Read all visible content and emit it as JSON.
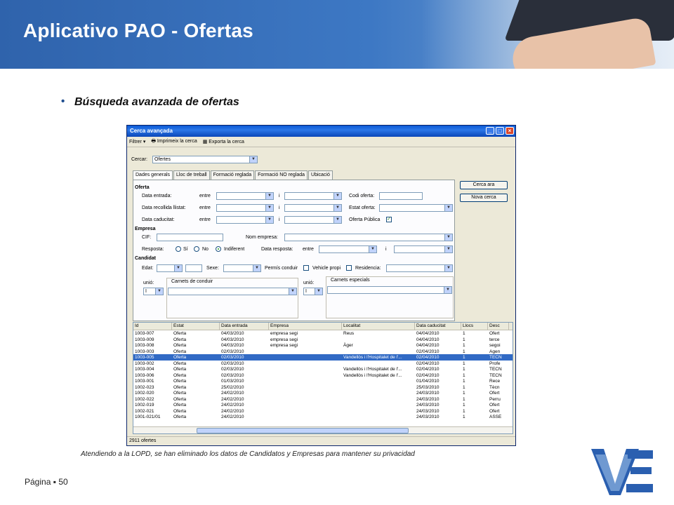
{
  "slide": {
    "title": "Aplicativo PAO - Ofertas",
    "bullet": "Búsqueda avanzada de ofertas",
    "footnote": "Atendiendo a la  LOPD, se han eliminado los datos de Candidatos y Empresas para mantener su privacidad",
    "page_label": "Página",
    "page_sep": "▪",
    "page_number": "50"
  },
  "window": {
    "title": "Cerca avançada",
    "toolbar": {
      "filter": "Filtrer",
      "print": "Imprimeix la cerca",
      "export": "Exporta la cerca"
    },
    "search_label": "Cercar:",
    "search_value": "Ofertes",
    "tabs": [
      "Dades generals",
      "Lloc de treball",
      "Formació reglada",
      "Formació NO reglada",
      "Ubicació"
    ],
    "buttons": {
      "search_now": "Cerca ara",
      "new_search": "Nova cerca"
    },
    "oferta": {
      "section": "Oferta",
      "data_entrada": "Data entrada:",
      "data_recollida": "Data recollida llistat:",
      "data_caducitat": "Data caducitat:",
      "entre": "entre",
      "i": "i",
      "codi_oferta": "Codi oferta:",
      "estat_oferta": "Estat oferta:",
      "oferta_publica": "Oferta Pública",
      "oferta_publica_checked": true
    },
    "empresa": {
      "section": "Empresa",
      "cif": "CIF:",
      "nom_empresa": "Nom empresa:",
      "resposta": "Resposta:",
      "si": "Sí",
      "no": "No",
      "indiferent": "Indiferent",
      "data_resposta": "Data resposta:"
    },
    "candidat": {
      "section": "Candidat",
      "edat": "Edat:",
      "sexe": "Sexe:",
      "permis": "Permís conduir",
      "vehicle": "Vehicle propi",
      "residencia": "Residencia:",
      "unio": "unió:",
      "unio_value": "I",
      "carnets_conduir": "Carnets de conduir",
      "carnets_especials": "Carnets especials"
    },
    "grid": {
      "columns": [
        "Id",
        "Estat",
        "Data entrada",
        "Empresa",
        "Localitat",
        "Data caducitat",
        "Llocs",
        "Desc"
      ],
      "rows": [
        [
          "1003-007",
          "Oferta",
          "04/03/2010",
          "empresa segi",
          "Reus",
          "04/04/2010",
          "1",
          "Ofert"
        ],
        [
          "1003-009",
          "Oferta",
          "04/03/2010",
          "empresa segi",
          "",
          "04/04/2010",
          "1",
          "terce"
        ],
        [
          "1003-008",
          "Oferta",
          "04/03/2010",
          "empresa segi",
          "Àger",
          "04/04/2010",
          "1",
          "segoi"
        ],
        [
          "1003-003",
          "Oferta",
          "02/03/2010",
          "",
          "",
          "02/04/2010",
          "1",
          "Agen"
        ],
        [
          "1003-005",
          "Oferta",
          "02/03/2010",
          "",
          "Vandellòs i l'Hospitalet de l'...",
          "02/04/2010",
          "1",
          "TECN"
        ],
        [
          "1003-002",
          "Oferta",
          "02/03/2010",
          "",
          "",
          "02/04/2010",
          "1",
          "Profe"
        ],
        [
          "1003-004",
          "Oferta",
          "02/03/2010",
          "",
          "Vandellòs i l'Hospitalet de l'...",
          "02/04/2010",
          "1",
          "TECN"
        ],
        [
          "1003-006",
          "Oferta",
          "02/03/2010",
          "",
          "Vandellòs i l'Hospitalet de l'...",
          "02/04/2010",
          "1",
          "TECN"
        ],
        [
          "1003-001",
          "Oferta",
          "01/03/2010",
          "",
          "",
          "01/04/2010",
          "1",
          "Rece"
        ],
        [
          "1002-023",
          "Oferta",
          "25/02/2010",
          "",
          "",
          "25/03/2010",
          "1",
          "Tècn"
        ],
        [
          "1002-020",
          "Oferta",
          "24/02/2010",
          "",
          "",
          "24/03/2010",
          "1",
          "Ofert"
        ],
        [
          "1002-022",
          "Oferta",
          "24/02/2010",
          "",
          "",
          "24/03/2010",
          "1",
          "Perru"
        ],
        [
          "1002-019",
          "Oferta",
          "24/02/2010",
          "",
          "",
          "24/03/2010",
          "1",
          "Ofert"
        ],
        [
          "1002-021",
          "Oferta",
          "24/02/2010",
          "",
          "",
          "24/03/2010",
          "1",
          "Ofert"
        ],
        [
          "1001-021/01",
          "Oferta",
          "24/02/2010",
          "",
          "",
          "24/03/2010",
          "1",
          "ASSE"
        ]
      ],
      "selected_row": 4
    },
    "status": "2911 ofertes"
  }
}
